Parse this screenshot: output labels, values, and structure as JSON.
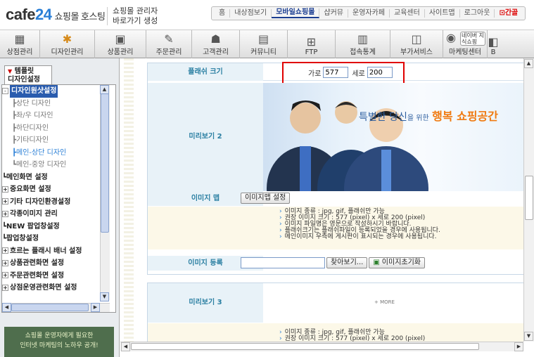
{
  "brand": {
    "logo_main": "cafe",
    "logo_num": "24",
    "logo_sub": "쇼핑몰 호스팅",
    "admin_line1": "쇼핑몰 관리자",
    "admin_line2": "바로가기 생성"
  },
  "topnav": [
    "홈",
    "내상점보기",
    "모바일쇼핑몰",
    "샵커뮤",
    "운영자카페",
    "교육센터",
    "사이트맵",
    "로그아웃",
    "⊡간골"
  ],
  "iconbar": [
    {
      "label": "상점관리",
      "icon": "store-icon"
    },
    {
      "label": "디자인관리",
      "icon": "palette-icon"
    },
    {
      "label": "상품관리",
      "icon": "box-icon"
    },
    {
      "label": "주문관리",
      "icon": "order-icon"
    },
    {
      "label": "고객관리",
      "icon": "customer-icon"
    },
    {
      "label": "커뮤니티",
      "icon": "community-icon"
    },
    {
      "label": "FTP",
      "icon": "ftp-icon"
    },
    {
      "label": "접속통계",
      "icon": "stats-icon"
    },
    {
      "label": "부가서비스",
      "icon": "service-icon"
    },
    {
      "label": "마케팅센터",
      "icon": "marketing-icon",
      "extra": "네이버 지식쇼핑"
    },
    {
      "label": "B",
      "icon": "b-icon"
    }
  ],
  "side": {
    "tab_label_1": "템플릿",
    "tab_label_2": "디자인설정",
    "tree": [
      {
        "label": "디자인원샷설정",
        "sel": true,
        "pm": "-"
      },
      {
        "label": "상단 디자인",
        "child": true
      },
      {
        "label": "좌/우 디자인",
        "child": true
      },
      {
        "label": "하단디자인",
        "child": true
      },
      {
        "label": "기타디자인",
        "child": true
      },
      {
        "label": "메인-상단 디자인",
        "child": true,
        "active": true
      },
      {
        "label": "메인-중앙 디자인",
        "child": true
      },
      {
        "label": "메인화면 설정",
        "bold": true,
        "dash": true
      },
      {
        "label": "중요화면 설정",
        "bold": true,
        "pm": "+"
      },
      {
        "label": "기타 디자인환경설정",
        "bold": true,
        "pm": "+"
      },
      {
        "label": "각종이미지 관리",
        "bold": true,
        "pm": "+"
      },
      {
        "label": "NEW 팝업창설정",
        "bold": true,
        "dash": true
      },
      {
        "label": "팝업창설정",
        "bold": true,
        "dash": true
      },
      {
        "label": "흐르는 플래시 배너 설정",
        "bold": true,
        "pm": "+"
      },
      {
        "label": "상품관련화면 설정",
        "bold": true,
        "pm": "+"
      },
      {
        "label": "주문관련화면 설정",
        "bold": true,
        "pm": "+"
      },
      {
        "label": "상점운영관련화면 설정",
        "bold": true,
        "pm": "+"
      }
    ],
    "banner_line1": "쇼핑몰 운영자에게 필요한",
    "banner_line2": "인터넷 마케팅의 노하우 공개!"
  },
  "form": {
    "flash_size_label": "플래쉬 크기",
    "width_label": "가로",
    "width_value": "577",
    "height_label": "세로",
    "height_value": "200",
    "preview2_label": "미리보기 2",
    "promo_pre": "특별한 당신",
    "promo_small": "을 위한",
    "promo_hl": "행복 쇼핑공간",
    "imagemap_label": "이미지 맵",
    "imagemap_button": "이미지맵 설정",
    "help1": [
      "이미지 종류 : jpg, gif, 플래쉬만 가능",
      "권장 이미지 크기 : 577 (pixel) x 세로 200 (pixel)",
      "이미지 파일명은 영문으로 작성하시기 바랍니다.",
      "플래쉬크기는 플래쉬파일이 등록되었을 경우에 사용됩니다.",
      "메인이미지 우측에 게시판이 표시되는 경우에 사용됩니다."
    ],
    "upload_label": "이미지 등록",
    "browse_button": "찾아보기...",
    "reset_button": "이미지초기화",
    "preview3_label": "미리보기 3",
    "more_text": "+ MORE",
    "help2": [
      "이미지 종류 : jpg, gif, 플래쉬만 가능",
      "권장 이미지 크기 : 577 (pixel) x 세로 200 (pixel)"
    ]
  }
}
